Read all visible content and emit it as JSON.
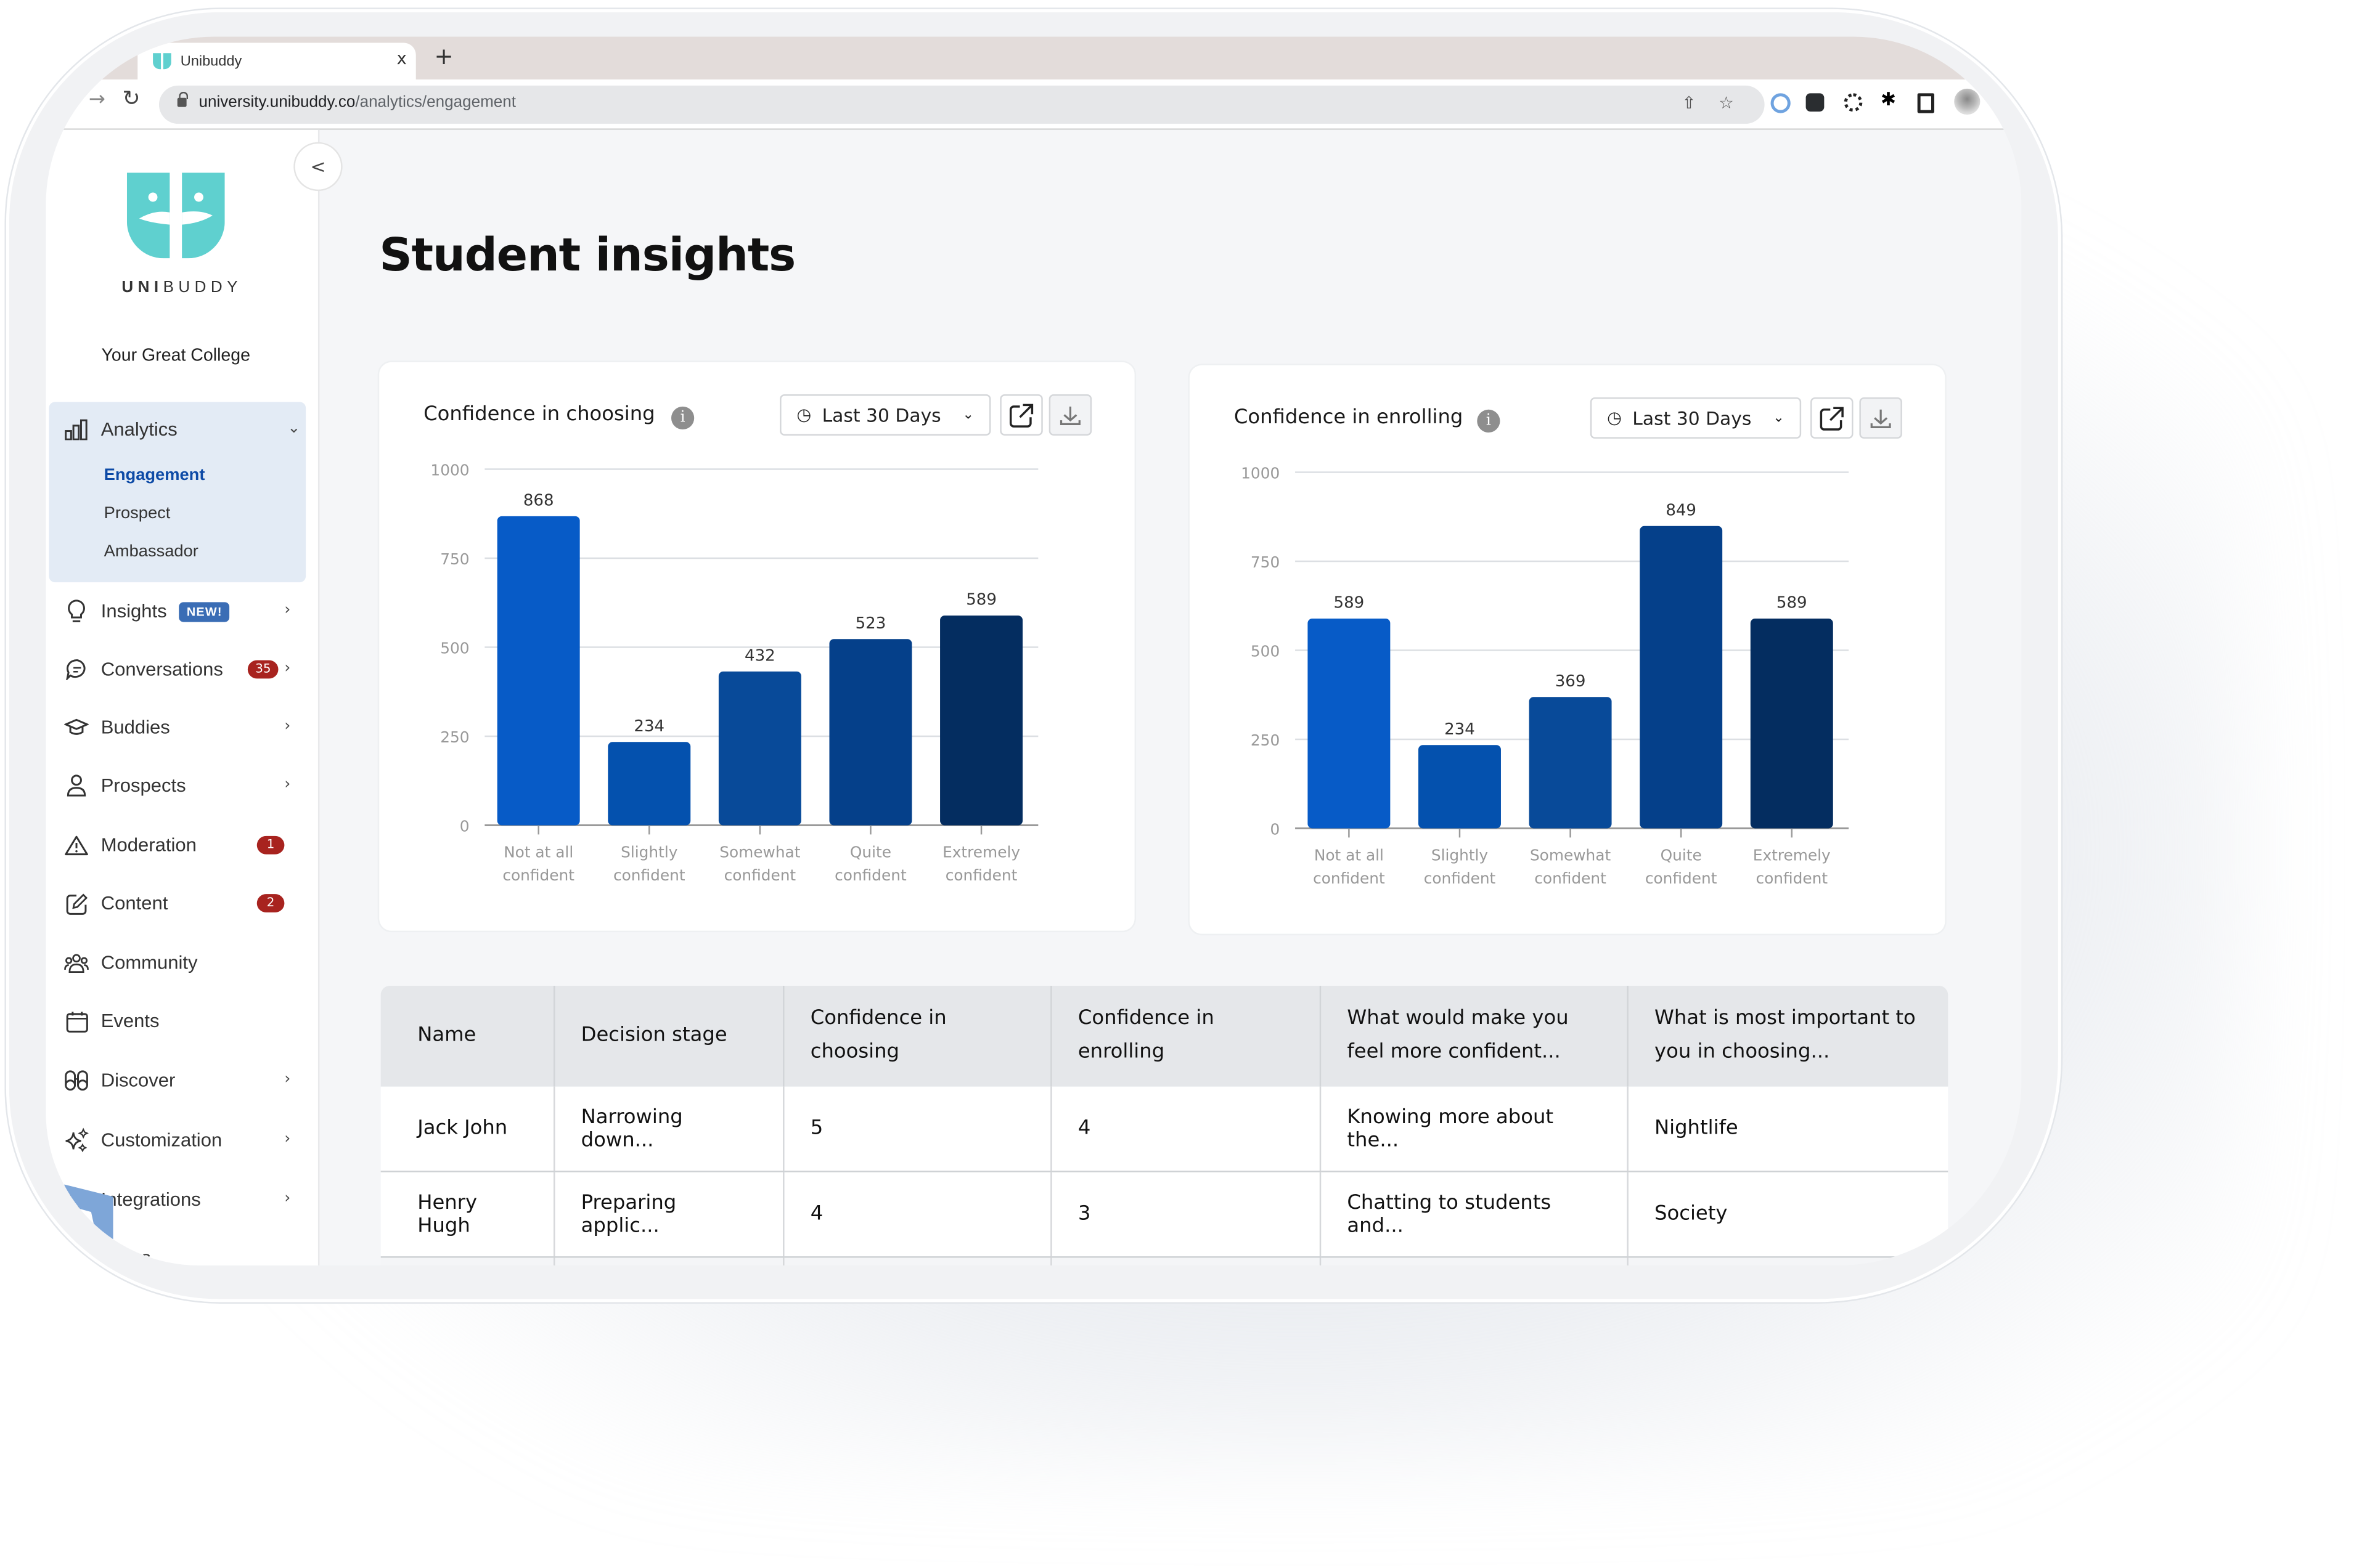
{
  "browser": {
    "tab_title": "Unibuddy",
    "tab_close": "x",
    "new_tab": "+",
    "url_host": "university.unibuddy.co",
    "url_path": "/analytics/engagement",
    "toolbar_icons": [
      "share-icon",
      "bookmark-star-icon",
      "password-manager-extension-icon",
      "ai-extension-icon",
      "loading-extension-icon",
      "extensions-puzzle-icon",
      "side-panel-icon",
      "profile-avatar"
    ]
  },
  "sidebar": {
    "brand_bold": "UNI",
    "brand_rest": "BUDDY",
    "college": "Your Great College",
    "collapse_glyph": "<",
    "analytics": {
      "label": "Analytics",
      "subitems": [
        {
          "label": "Engagement",
          "active": true
        },
        {
          "label": "Prospect",
          "active": false
        },
        {
          "label": "Ambassador",
          "active": false
        }
      ]
    },
    "items": [
      {
        "label": "Insights",
        "icon": "lightbulb-icon",
        "tag": "NEW!",
        "chevron": true
      },
      {
        "label": "Conversations",
        "icon": "chat-bubble-icon",
        "badge": "35",
        "chevron": true
      },
      {
        "label": "Buddies",
        "icon": "graduation-cap-icon",
        "chevron": true
      },
      {
        "label": "Prospects",
        "icon": "person-icon",
        "chevron": true
      },
      {
        "label": "Moderation",
        "icon": "warning-triangle-icon",
        "badge": "1",
        "chevron": false
      },
      {
        "label": "Content",
        "icon": "edit-square-icon",
        "badge": "2",
        "chevron": false
      },
      {
        "label": "Community",
        "icon": "people-group-icon",
        "chevron": false
      },
      {
        "label": "Events",
        "icon": "calendar-icon",
        "chevron": false
      },
      {
        "label": "Discover",
        "icon": "binoculars-icon",
        "chevron": true
      },
      {
        "label": "Customization",
        "icon": "sparkles-icon",
        "chevron": true
      },
      {
        "label": "Integrations",
        "icon": "plug-icon",
        "chevron": true
      },
      {
        "label": "Users",
        "icon": "users-icon",
        "chevron": false
      }
    ]
  },
  "main": {
    "title": "Student insights",
    "date_range": "Last 30 Days",
    "table": {
      "headers": [
        "Name",
        "Decision stage",
        "Confidence in choosing",
        "Confidence in enrolling",
        "What would make you feel more confident...",
        "What is most important to you in choosing..."
      ],
      "rows": [
        [
          "Jack John",
          "Narrowing down...",
          "5",
          "4",
          "Knowing more about the...",
          "Nightlife"
        ],
        [
          "Henry Hugh",
          "Preparing applic...",
          "4",
          "3",
          "Chatting to students and...",
          "Society"
        ]
      ]
    }
  },
  "colors": {
    "brand_teal": "#5fd0cf",
    "bar_1": "#075bc7",
    "bar_2": "#0451ae",
    "bar_3": "#084a99",
    "bar_4": "#05408a",
    "bar_5": "#042d60",
    "badge_red": "#a8231f",
    "badge_new": "#3a6db5",
    "active_link": "#0d4aa6"
  },
  "chart_data": [
    {
      "type": "bar",
      "title": "Confidence in choosing",
      "categories": [
        "Not at all confident",
        "Slightly confident",
        "Somewhat confident",
        "Quite confident",
        "Extremely confident"
      ],
      "category_lines": [
        [
          "Not at all",
          "confident"
        ],
        [
          "Slightly",
          "confident"
        ],
        [
          "Somewhat",
          "confident"
        ],
        [
          "Quite",
          "confident"
        ],
        [
          "Extremely",
          "confident"
        ]
      ],
      "values": [
        868,
        234,
        432,
        523,
        589
      ],
      "ylim": [
        0,
        1000
      ],
      "yticks": [
        0,
        250,
        500,
        750,
        1000
      ],
      "xlabel": "",
      "ylabel": "",
      "grid": true,
      "legend": "none",
      "data_labels": true
    },
    {
      "type": "bar",
      "title": "Confidence in enrolling",
      "categories": [
        "Not at all confident",
        "Slightly confident",
        "Somewhat confident",
        "Quite confident",
        "Extremely confident"
      ],
      "category_lines": [
        [
          "Not at all",
          "confident"
        ],
        [
          "Slightly",
          "confident"
        ],
        [
          "Somewhat",
          "confident"
        ],
        [
          "Quite",
          "confident"
        ],
        [
          "Extremely",
          "confident"
        ]
      ],
      "values": [
        589,
        234,
        369,
        849,
        589
      ],
      "ylim": [
        0,
        1000
      ],
      "yticks": [
        0,
        250,
        500,
        750,
        1000
      ],
      "xlabel": "",
      "ylabel": "",
      "grid": true,
      "legend": "none",
      "data_labels": true
    }
  ]
}
